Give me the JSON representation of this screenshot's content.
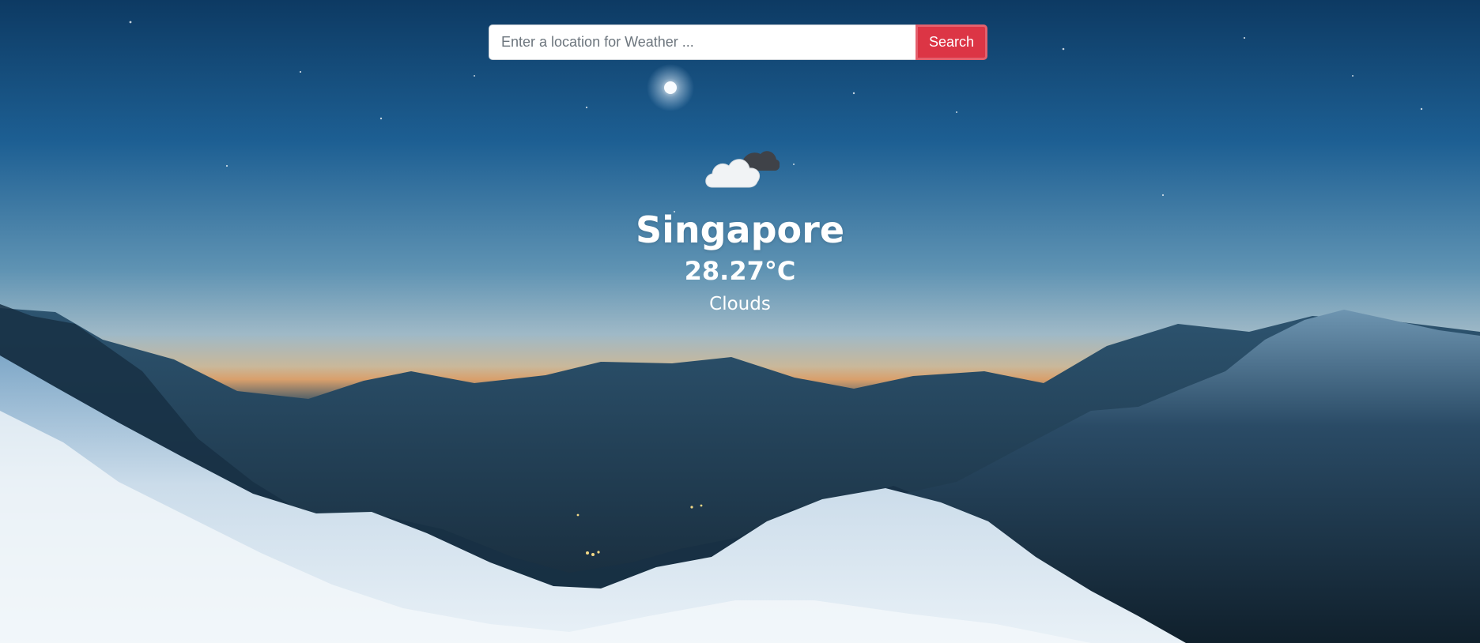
{
  "search": {
    "placeholder": "Enter a location for Weather ...",
    "value": "",
    "button_label": "Search"
  },
  "weather": {
    "icon": "cloud-icon",
    "city": "Singapore",
    "temperature": "28.27°C",
    "condition": "Clouds"
  },
  "colors": {
    "button": "#dc3545",
    "text": "#ffffff"
  }
}
